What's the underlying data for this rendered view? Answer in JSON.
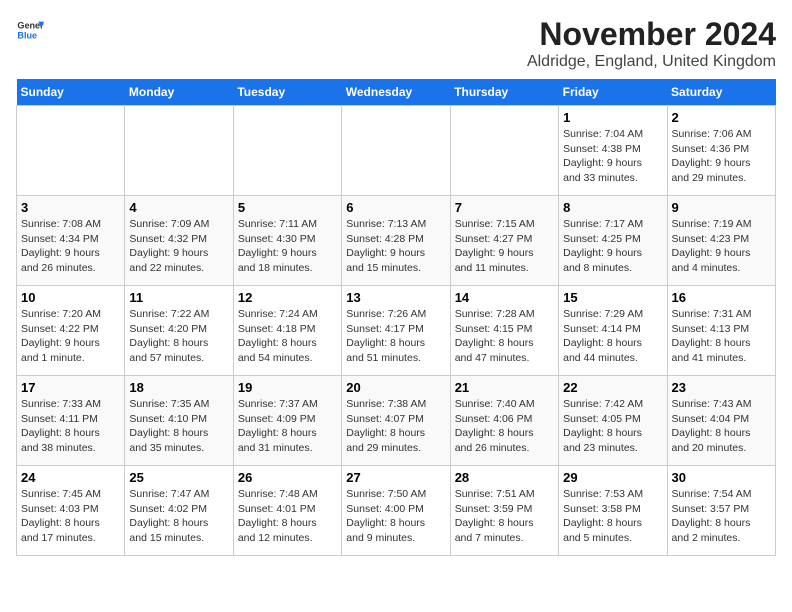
{
  "header": {
    "logo_general": "General",
    "logo_blue": "Blue",
    "title": "November 2024",
    "subtitle": "Aldridge, England, United Kingdom"
  },
  "weekdays": [
    "Sunday",
    "Monday",
    "Tuesday",
    "Wednesday",
    "Thursday",
    "Friday",
    "Saturday"
  ],
  "weeks": [
    [
      {
        "day": "",
        "info": ""
      },
      {
        "day": "",
        "info": ""
      },
      {
        "day": "",
        "info": ""
      },
      {
        "day": "",
        "info": ""
      },
      {
        "day": "",
        "info": ""
      },
      {
        "day": "1",
        "info": "Sunrise: 7:04 AM\nSunset: 4:38 PM\nDaylight: 9 hours\nand 33 minutes."
      },
      {
        "day": "2",
        "info": "Sunrise: 7:06 AM\nSunset: 4:36 PM\nDaylight: 9 hours\nand 29 minutes."
      }
    ],
    [
      {
        "day": "3",
        "info": "Sunrise: 7:08 AM\nSunset: 4:34 PM\nDaylight: 9 hours\nand 26 minutes."
      },
      {
        "day": "4",
        "info": "Sunrise: 7:09 AM\nSunset: 4:32 PM\nDaylight: 9 hours\nand 22 minutes."
      },
      {
        "day": "5",
        "info": "Sunrise: 7:11 AM\nSunset: 4:30 PM\nDaylight: 9 hours\nand 18 minutes."
      },
      {
        "day": "6",
        "info": "Sunrise: 7:13 AM\nSunset: 4:28 PM\nDaylight: 9 hours\nand 15 minutes."
      },
      {
        "day": "7",
        "info": "Sunrise: 7:15 AM\nSunset: 4:27 PM\nDaylight: 9 hours\nand 11 minutes."
      },
      {
        "day": "8",
        "info": "Sunrise: 7:17 AM\nSunset: 4:25 PM\nDaylight: 9 hours\nand 8 minutes."
      },
      {
        "day": "9",
        "info": "Sunrise: 7:19 AM\nSunset: 4:23 PM\nDaylight: 9 hours\nand 4 minutes."
      }
    ],
    [
      {
        "day": "10",
        "info": "Sunrise: 7:20 AM\nSunset: 4:22 PM\nDaylight: 9 hours\nand 1 minute."
      },
      {
        "day": "11",
        "info": "Sunrise: 7:22 AM\nSunset: 4:20 PM\nDaylight: 8 hours\nand 57 minutes."
      },
      {
        "day": "12",
        "info": "Sunrise: 7:24 AM\nSunset: 4:18 PM\nDaylight: 8 hours\nand 54 minutes."
      },
      {
        "day": "13",
        "info": "Sunrise: 7:26 AM\nSunset: 4:17 PM\nDaylight: 8 hours\nand 51 minutes."
      },
      {
        "day": "14",
        "info": "Sunrise: 7:28 AM\nSunset: 4:15 PM\nDaylight: 8 hours\nand 47 minutes."
      },
      {
        "day": "15",
        "info": "Sunrise: 7:29 AM\nSunset: 4:14 PM\nDaylight: 8 hours\nand 44 minutes."
      },
      {
        "day": "16",
        "info": "Sunrise: 7:31 AM\nSunset: 4:13 PM\nDaylight: 8 hours\nand 41 minutes."
      }
    ],
    [
      {
        "day": "17",
        "info": "Sunrise: 7:33 AM\nSunset: 4:11 PM\nDaylight: 8 hours\nand 38 minutes."
      },
      {
        "day": "18",
        "info": "Sunrise: 7:35 AM\nSunset: 4:10 PM\nDaylight: 8 hours\nand 35 minutes."
      },
      {
        "day": "19",
        "info": "Sunrise: 7:37 AM\nSunset: 4:09 PM\nDaylight: 8 hours\nand 31 minutes."
      },
      {
        "day": "20",
        "info": "Sunrise: 7:38 AM\nSunset: 4:07 PM\nDaylight: 8 hours\nand 29 minutes."
      },
      {
        "day": "21",
        "info": "Sunrise: 7:40 AM\nSunset: 4:06 PM\nDaylight: 8 hours\nand 26 minutes."
      },
      {
        "day": "22",
        "info": "Sunrise: 7:42 AM\nSunset: 4:05 PM\nDaylight: 8 hours\nand 23 minutes."
      },
      {
        "day": "23",
        "info": "Sunrise: 7:43 AM\nSunset: 4:04 PM\nDaylight: 8 hours\nand 20 minutes."
      }
    ],
    [
      {
        "day": "24",
        "info": "Sunrise: 7:45 AM\nSunset: 4:03 PM\nDaylight: 8 hours\nand 17 minutes."
      },
      {
        "day": "25",
        "info": "Sunrise: 7:47 AM\nSunset: 4:02 PM\nDaylight: 8 hours\nand 15 minutes."
      },
      {
        "day": "26",
        "info": "Sunrise: 7:48 AM\nSunset: 4:01 PM\nDaylight: 8 hours\nand 12 minutes."
      },
      {
        "day": "27",
        "info": "Sunrise: 7:50 AM\nSunset: 4:00 PM\nDaylight: 8 hours\nand 9 minutes."
      },
      {
        "day": "28",
        "info": "Sunrise: 7:51 AM\nSunset: 3:59 PM\nDaylight: 8 hours\nand 7 minutes."
      },
      {
        "day": "29",
        "info": "Sunrise: 7:53 AM\nSunset: 3:58 PM\nDaylight: 8 hours\nand 5 minutes."
      },
      {
        "day": "30",
        "info": "Sunrise: 7:54 AM\nSunset: 3:57 PM\nDaylight: 8 hours\nand 2 minutes."
      }
    ]
  ]
}
